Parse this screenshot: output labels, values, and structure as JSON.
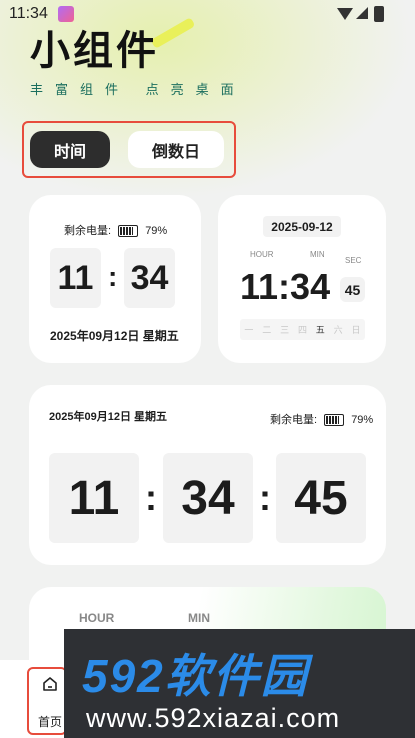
{
  "status_bar": {
    "time": "11:34"
  },
  "header": {
    "title": "小组件",
    "subtitle": "丰富组件 点亮桌面"
  },
  "tabs": [
    {
      "label": "时间",
      "active": true
    },
    {
      "label": "倒数日",
      "active": false
    }
  ],
  "widget_battery_clock": {
    "battery_label": "剩余电量:",
    "battery_percent": "79%",
    "hour": "11",
    "minute": "34",
    "separator": ":",
    "date": "2025年09月12日 星期五"
  },
  "widget_digital_clock": {
    "date": "2025-09-12",
    "hour_label": "HOUR",
    "min_label": "MIN",
    "sec_label": "SEC",
    "time": "11:34",
    "seconds": "45",
    "weekdays": [
      "一",
      "二",
      "三",
      "四",
      "五",
      "六",
      "日"
    ],
    "current_weekday_index": 4
  },
  "widget_large_clock": {
    "date": "2025年09月12日 星期五",
    "battery_label": "剩余电量:",
    "battery_percent": "79%",
    "hour": "11",
    "minute": "34",
    "second": "45",
    "separator": ":"
  },
  "widget_partial": {
    "hour_label": "HOUR",
    "min_label": "MIN"
  },
  "bottom_nav": {
    "home_label": "首页"
  },
  "watermark": {
    "logo_text": "592软件园",
    "url": "www.592xiazai.com"
  },
  "colors": {
    "accent_dark": "#2d2d2d",
    "highlight_outline": "#e74c3c",
    "subtitle_green": "#1b6e5e",
    "watermark_blue": "#2b8be8"
  }
}
